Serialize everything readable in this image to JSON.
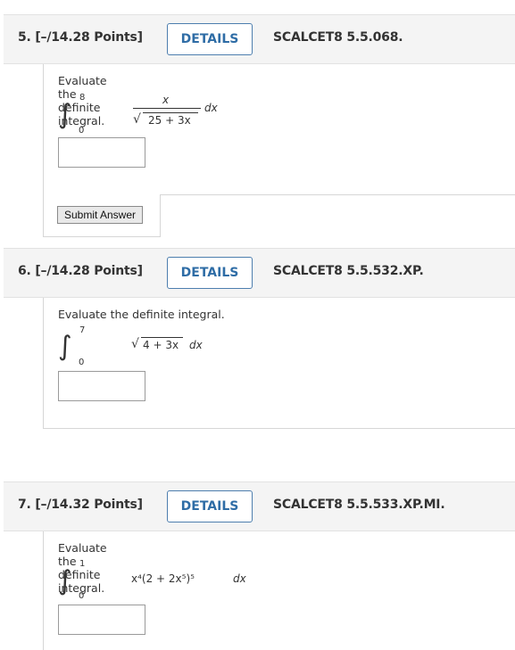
{
  "questions": [
    {
      "title": "5. [–/14.28 Points]",
      "details_label": "DETAILS",
      "code": "SCALCET8 5.5.068.",
      "prompt": "Evaluate the definite integral.",
      "upper": "8",
      "lower": "0",
      "numerator": "x",
      "denominator": "25 + 3x",
      "dx": "dx",
      "submit_label": "Submit Answer"
    },
    {
      "title": "6. [–/14.28 Points]",
      "details_label": "DETAILS",
      "code": "SCALCET8 5.5.532.XP.",
      "prompt": "Evaluate the definite integral.",
      "upper": "7",
      "lower": "0",
      "radicand": "4 + 3x",
      "dx": "dx"
    },
    {
      "title": "7. [–/14.32 Points]",
      "details_label": "DETAILS",
      "code": "SCALCET8 5.5.533.XP.MI.",
      "prompt": "Evaluate the definite integral.",
      "upper": "1",
      "lower": "0",
      "integrand": "x⁴(2 + 2x⁵)⁵",
      "dx": "dx"
    }
  ],
  "colors": {
    "header_bg": "#f4f4f4",
    "details_border": "#4d7eae",
    "details_text": "#2f6da6",
    "text": "#333333"
  }
}
